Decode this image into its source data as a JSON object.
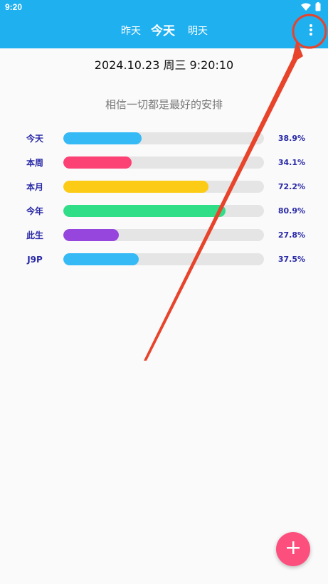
{
  "status_bar": {
    "time": "9:20",
    "icons": [
      "wifi-icon",
      "battery-icon"
    ]
  },
  "app_bar": {
    "tabs": [
      {
        "label": "昨天",
        "selected": false
      },
      {
        "label": "今天",
        "selected": true
      },
      {
        "label": "明天",
        "selected": false
      }
    ],
    "menu_icon": "more-vert-icon"
  },
  "main": {
    "datetime": "2024.10.23 周三 9:20:10",
    "motto": "相信一切都是最好的安排",
    "progress": [
      {
        "label": "今天",
        "percent_text": "38.9%",
        "value": 0.389,
        "color": "#36baf5"
      },
      {
        "label": "本周",
        "percent_text": "34.1%",
        "value": 0.341,
        "color": "#fc4175"
      },
      {
        "label": "本月",
        "percent_text": "72.2%",
        "value": 0.722,
        "color": "#fccb16"
      },
      {
        "label": "今年",
        "percent_text": "80.9%",
        "value": 0.809,
        "color": "#30de88"
      },
      {
        "label": "此生",
        "percent_text": "27.8%",
        "value": 0.278,
        "color": "#9646dc"
      },
      {
        "label": "J9P",
        "percent_text": "37.5%",
        "value": 0.375,
        "color": "#36baf5"
      }
    ]
  },
  "fab": {
    "icon": "plus-icon",
    "color": "#fd4f7d"
  },
  "annotation": {
    "color": "#e8432b"
  },
  "theme": {
    "primary": "#1fb0f0",
    "label_color": "#2a2aa8"
  }
}
